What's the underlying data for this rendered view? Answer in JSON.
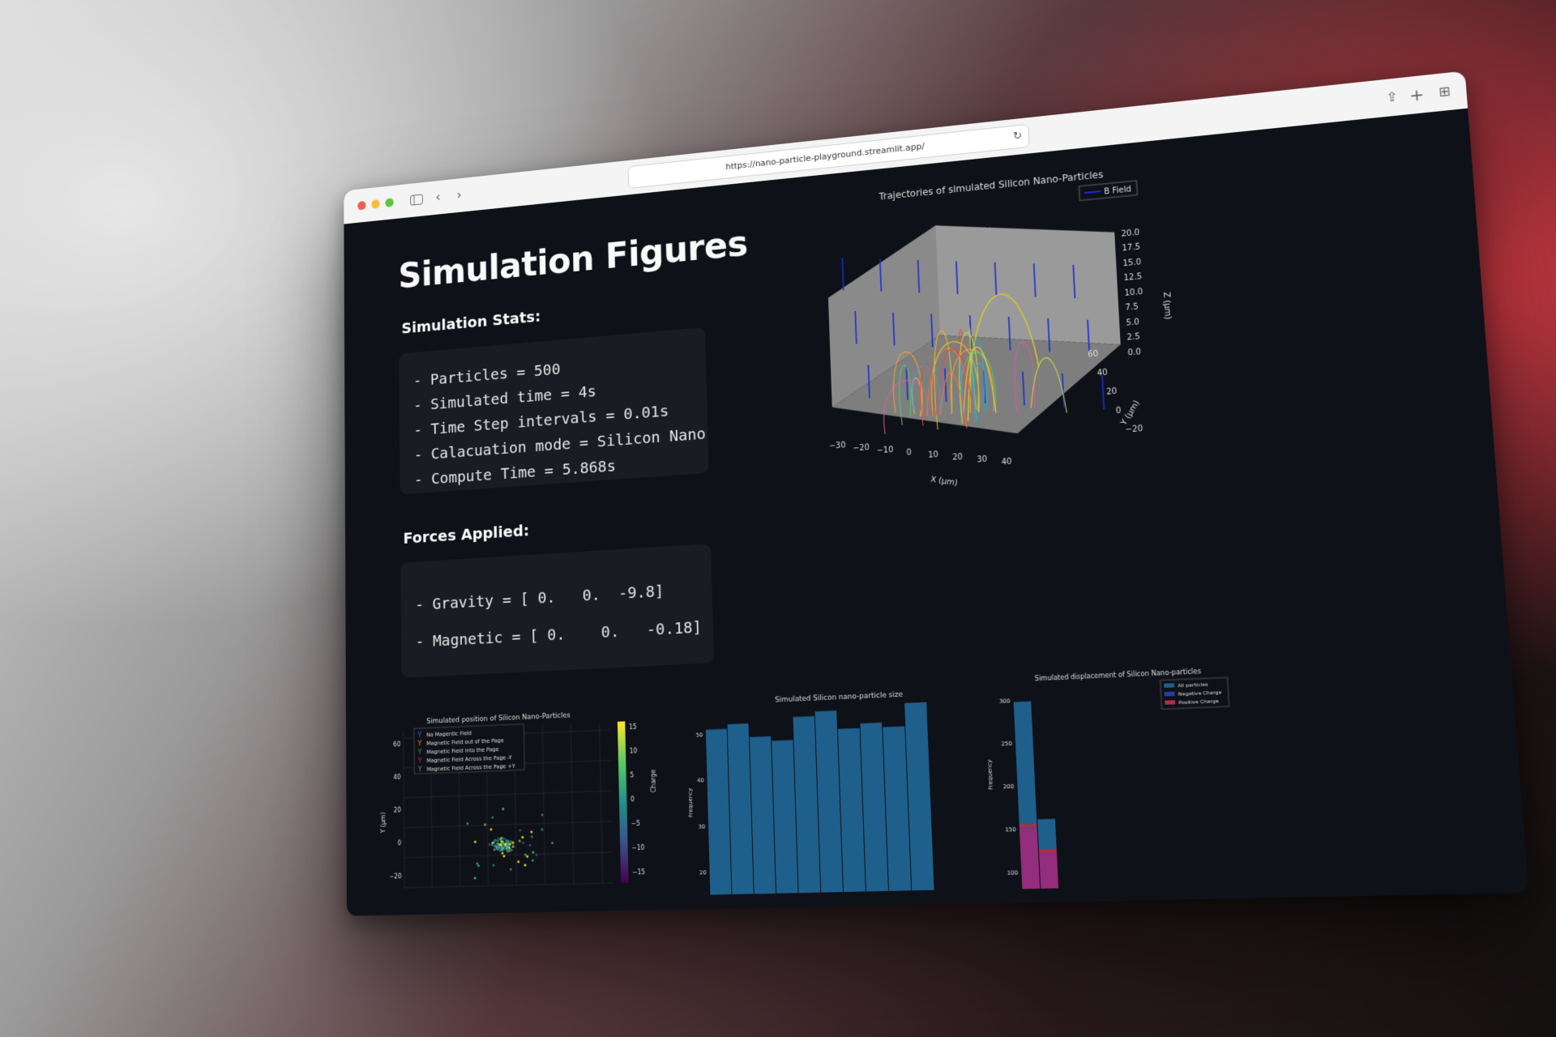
{
  "browser": {
    "url": "https://nano-particle-playground.streamlit.app/"
  },
  "page": {
    "title": "Simulation Figures",
    "stats_heading": "Simulation Stats:",
    "stats_lines": [
      "- Particles = 500",
      "- Simulated time = 4s",
      "- Time Step intervals = 0.01s",
      "- Calacuation mode = Silicon Nano-Part",
      "- Compute Time = 5.868s"
    ],
    "forces_heading": "Forces Applied:",
    "forces_lines": [
      "- Gravity = [ 0.   0.  -9.8]",
      "- Magnetic = [ 0.    0.   -0.18]"
    ]
  },
  "colors": {
    "background": "#0e1117",
    "codebox": "#1a1c24",
    "bar_blue": "#1f5f8b",
    "negative": "#1f3fb0",
    "positive": "#b02a4a"
  },
  "figures": {
    "traj": {
      "title": "Trajectories of simulated Silicon Nano-Particles",
      "legend": "B Field",
      "x_label": "X (μm)",
      "y_label": "Y (μm)",
      "z_label": "Z (μm)",
      "x_ticks": [
        "−30",
        "−20",
        "−10",
        "0",
        "10",
        "20",
        "30",
        "40"
      ],
      "y_ticks": [
        "60",
        "40",
        "20",
        "0",
        "−20"
      ],
      "z_ticks": [
        "20.0",
        "17.5",
        "15.0",
        "12.5",
        "10.0",
        "7.5",
        "5.0",
        "2.5",
        "0.0"
      ]
    },
    "position": {
      "title": "Simulated position of Silicon Nano-Particles",
      "legend": [
        "No Magentic Field",
        "Magnetic Field out of the Page",
        "Magnetic Field into the Page",
        "Magnetic Field Across the Page -Y",
        "Magnetic Field Across the Page +Y"
      ],
      "y_label": "Y (μm)",
      "y_ticks": [
        "60",
        "40",
        "20",
        "0",
        "−20"
      ],
      "colorbar_label": "Charge",
      "colorbar_ticks": [
        "15",
        "10",
        "5",
        "0",
        "−5",
        "−10",
        "−15"
      ]
    },
    "size": {
      "title": "Simulated Silicon nano-particle size",
      "y_label": "Frequency",
      "y_ticks": [
        "50",
        "40",
        "30",
        "20"
      ]
    },
    "displacement": {
      "title": "Simulated displacement of Silicon Nano-particles",
      "y_label": "Frequency",
      "y_ticks": [
        "300",
        "250",
        "200",
        "150",
        "100"
      ],
      "legend": [
        "All particles",
        "Negative Charge",
        "Positive Charge"
      ]
    }
  },
  "chart_data": [
    {
      "type": "bar",
      "title": "Simulated Silicon nano-particle size",
      "ylabel": "Frequency",
      "ylim": [
        15,
        55
      ],
      "values": [
        51,
        52,
        49,
        48,
        53,
        54,
        50,
        51,
        50,
        55
      ]
    },
    {
      "type": "bar",
      "title": "Simulated displacement of Silicon Nano-particles",
      "ylabel": "Frequency",
      "ylim": [
        80,
        310
      ],
      "series": [
        {
          "name": "All particles",
          "values": [
            298,
            160
          ]
        },
        {
          "name": "Negative Charge",
          "values": [
            155,
            125
          ]
        },
        {
          "name": "Positive Charge",
          "values": [
            150,
            125
          ]
        }
      ]
    }
  ]
}
